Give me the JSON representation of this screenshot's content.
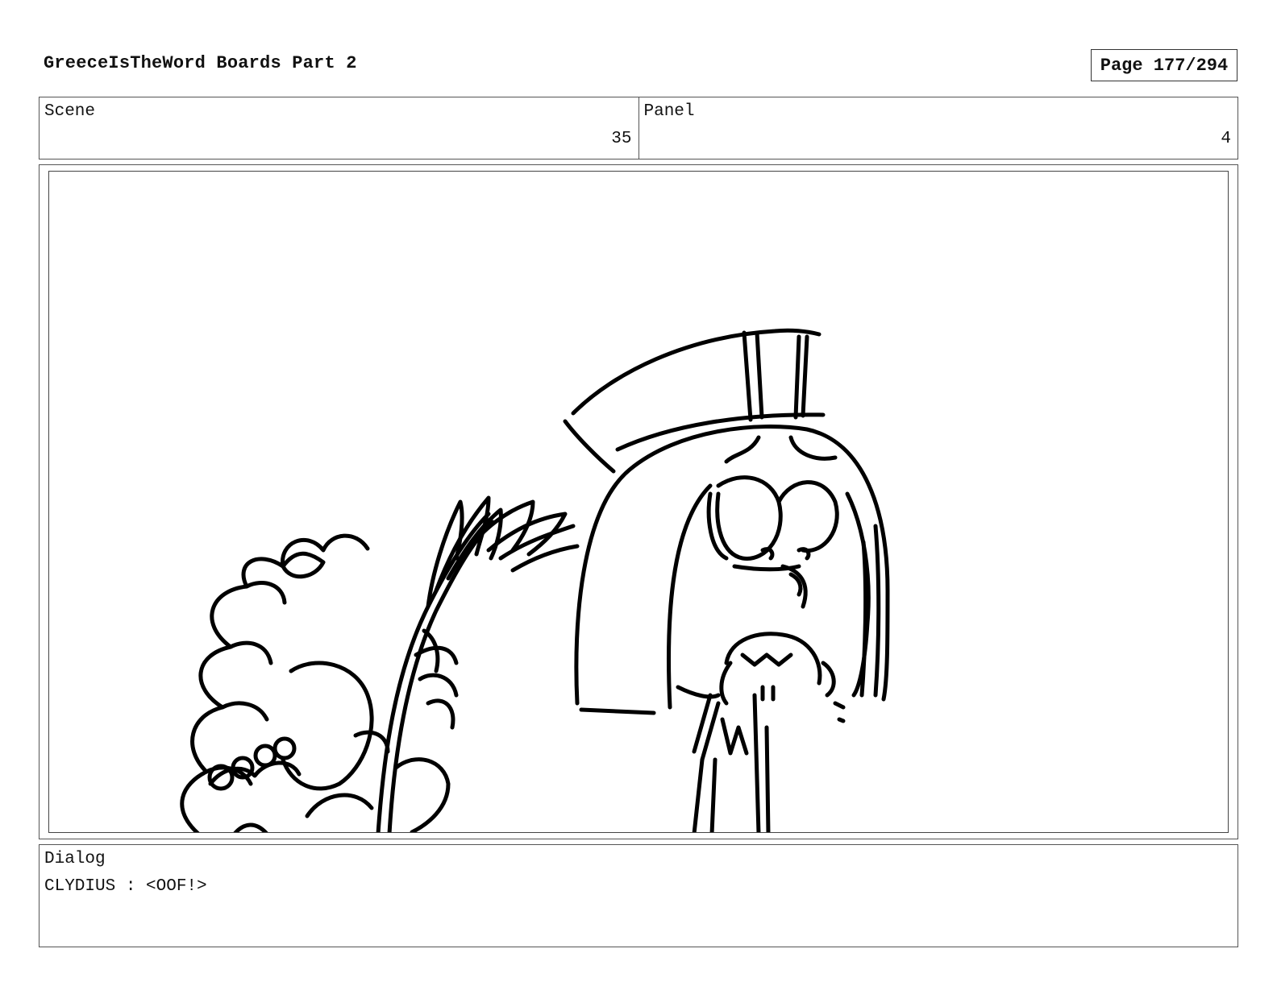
{
  "header": {
    "title": "GreeceIsTheWord Boards Part 2",
    "page": "Page 177/294"
  },
  "info": {
    "scene_label": "Scene",
    "scene_value": "35",
    "panel_label": "Panel",
    "panel_value": "4"
  },
  "dialog": {
    "label": "Dialog",
    "line": "CLYDIUS : <OOF!>"
  }
}
